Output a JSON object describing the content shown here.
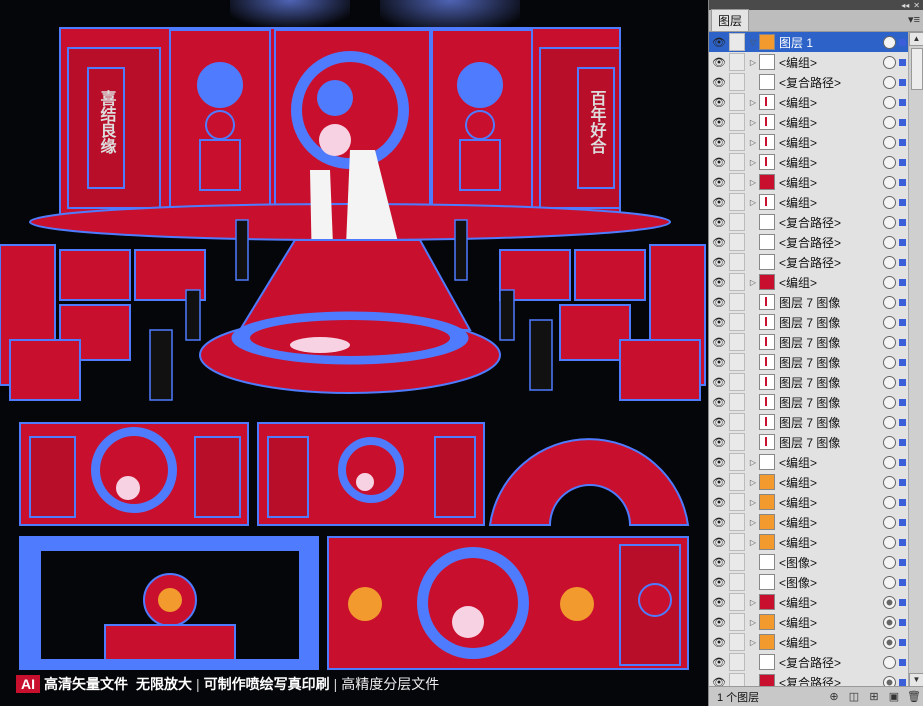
{
  "banner": {
    "ai": "AI",
    "t1": "高清矢量文件",
    "t2": "无限放大",
    "t3": "可制作喷绘写真印刷",
    "t4": "高精度分层文件",
    "sep": "|"
  },
  "canvas_text": {
    "left_panel": "喜结良缘",
    "right_panel": "百年好合"
  },
  "panel": {
    "tab": "图层",
    "menu_icon": "▾≡",
    "collapse_icon": "◂◂",
    "close_icon": "✕",
    "layer_count": "1 个图层",
    "rows": [
      {
        "label": "图层 1",
        "thumb": "orange",
        "eye": "👁",
        "arrow": "▽",
        "sel": true,
        "target": "empty"
      },
      {
        "label": "<编组>",
        "thumb": "white",
        "eye": "👁",
        "arrow": "▷",
        "target": "empty"
      },
      {
        "label": "<复合路径>",
        "thumb": "white",
        "eye": "👁",
        "arrow": "",
        "target": "empty"
      },
      {
        "label": "<编组>",
        "thumb": "mark",
        "eye": "👁",
        "arrow": "▷",
        "target": "empty"
      },
      {
        "label": "<编组>",
        "thumb": "mark",
        "eye": "👁",
        "arrow": "▷",
        "target": "empty"
      },
      {
        "label": "<编组>",
        "thumb": "mark",
        "eye": "👁",
        "arrow": "▷",
        "target": "empty"
      },
      {
        "label": "<编组>",
        "thumb": "mark",
        "eye": "👁",
        "arrow": "▷",
        "target": "empty"
      },
      {
        "label": "<编组>",
        "thumb": "red",
        "eye": "👁",
        "arrow": "▷",
        "target": "empty"
      },
      {
        "label": "<编组>",
        "thumb": "mark",
        "eye": "👁",
        "arrow": "▷",
        "target": "empty"
      },
      {
        "label": "<复合路径>",
        "thumb": "white",
        "eye": "👁",
        "arrow": "",
        "target": "empty"
      },
      {
        "label": "<复合路径>",
        "thumb": "white",
        "eye": "👁",
        "arrow": "",
        "target": "empty"
      },
      {
        "label": "<复合路径>",
        "thumb": "white",
        "eye": "👁",
        "arrow": "",
        "target": "empty"
      },
      {
        "label": "<编组>",
        "thumb": "red",
        "eye": "👁",
        "arrow": "▷",
        "target": "empty"
      },
      {
        "label": "图层 7 图像",
        "thumb": "mark",
        "eye": "👁",
        "arrow": "",
        "target": "empty"
      },
      {
        "label": "图层 7 图像",
        "thumb": "mark",
        "eye": "👁",
        "arrow": "",
        "target": "empty"
      },
      {
        "label": "图层 7 图像",
        "thumb": "mark",
        "eye": "👁",
        "arrow": "",
        "target": "empty"
      },
      {
        "label": "图层 7 图像",
        "thumb": "mark",
        "eye": "👁",
        "arrow": "",
        "target": "empty"
      },
      {
        "label": "图层 7 图像",
        "thumb": "mark",
        "eye": "👁",
        "arrow": "",
        "target": "empty"
      },
      {
        "label": "图层 7 图像",
        "thumb": "mark",
        "eye": "👁",
        "arrow": "",
        "target": "empty"
      },
      {
        "label": "图层 7 图像",
        "thumb": "mark",
        "eye": "👁",
        "arrow": "",
        "target": "empty"
      },
      {
        "label": "图层 7 图像",
        "thumb": "mark",
        "eye": "👁",
        "arrow": "",
        "target": "empty"
      },
      {
        "label": "<编组>",
        "thumb": "white",
        "eye": "👁",
        "arrow": "▷",
        "target": "empty"
      },
      {
        "label": "<编组>",
        "thumb": "orange",
        "eye": "👁",
        "arrow": "▷",
        "target": "empty"
      },
      {
        "label": "<编组>",
        "thumb": "orange",
        "eye": "👁",
        "arrow": "▷",
        "target": "empty"
      },
      {
        "label": "<编组>",
        "thumb": "orange",
        "eye": "👁",
        "arrow": "▷",
        "target": "empty"
      },
      {
        "label": "<编组>",
        "thumb": "orange",
        "eye": "👁",
        "arrow": "▷",
        "target": "empty"
      },
      {
        "label": "<图像>",
        "thumb": "white",
        "eye": "👁",
        "arrow": "",
        "target": "empty"
      },
      {
        "label": "<图像>",
        "thumb": "white",
        "eye": "👁",
        "arrow": "",
        "target": "empty"
      },
      {
        "label": "<编组>",
        "thumb": "red",
        "eye": "👁",
        "arrow": "▷",
        "target": "filled"
      },
      {
        "label": "<编组>",
        "thumb": "orange",
        "eye": "👁",
        "arrow": "▷",
        "target": "filled"
      },
      {
        "label": "<编组>",
        "thumb": "orange",
        "eye": "👁",
        "arrow": "▷",
        "target": "filled"
      },
      {
        "label": "<复合路径>",
        "thumb": "white",
        "eye": "👁",
        "arrow": "",
        "target": "empty"
      },
      {
        "label": "<复合路径>",
        "thumb": "red",
        "eye": "👁",
        "arrow": "",
        "target": "filled"
      }
    ]
  },
  "colors": {
    "canvas_bg": "#05060a",
    "selection_blue": "#4f7bff",
    "stage_red": "#c8102e",
    "panel_bg": "#d4d4d4",
    "row_selected": "#2d63c8"
  }
}
